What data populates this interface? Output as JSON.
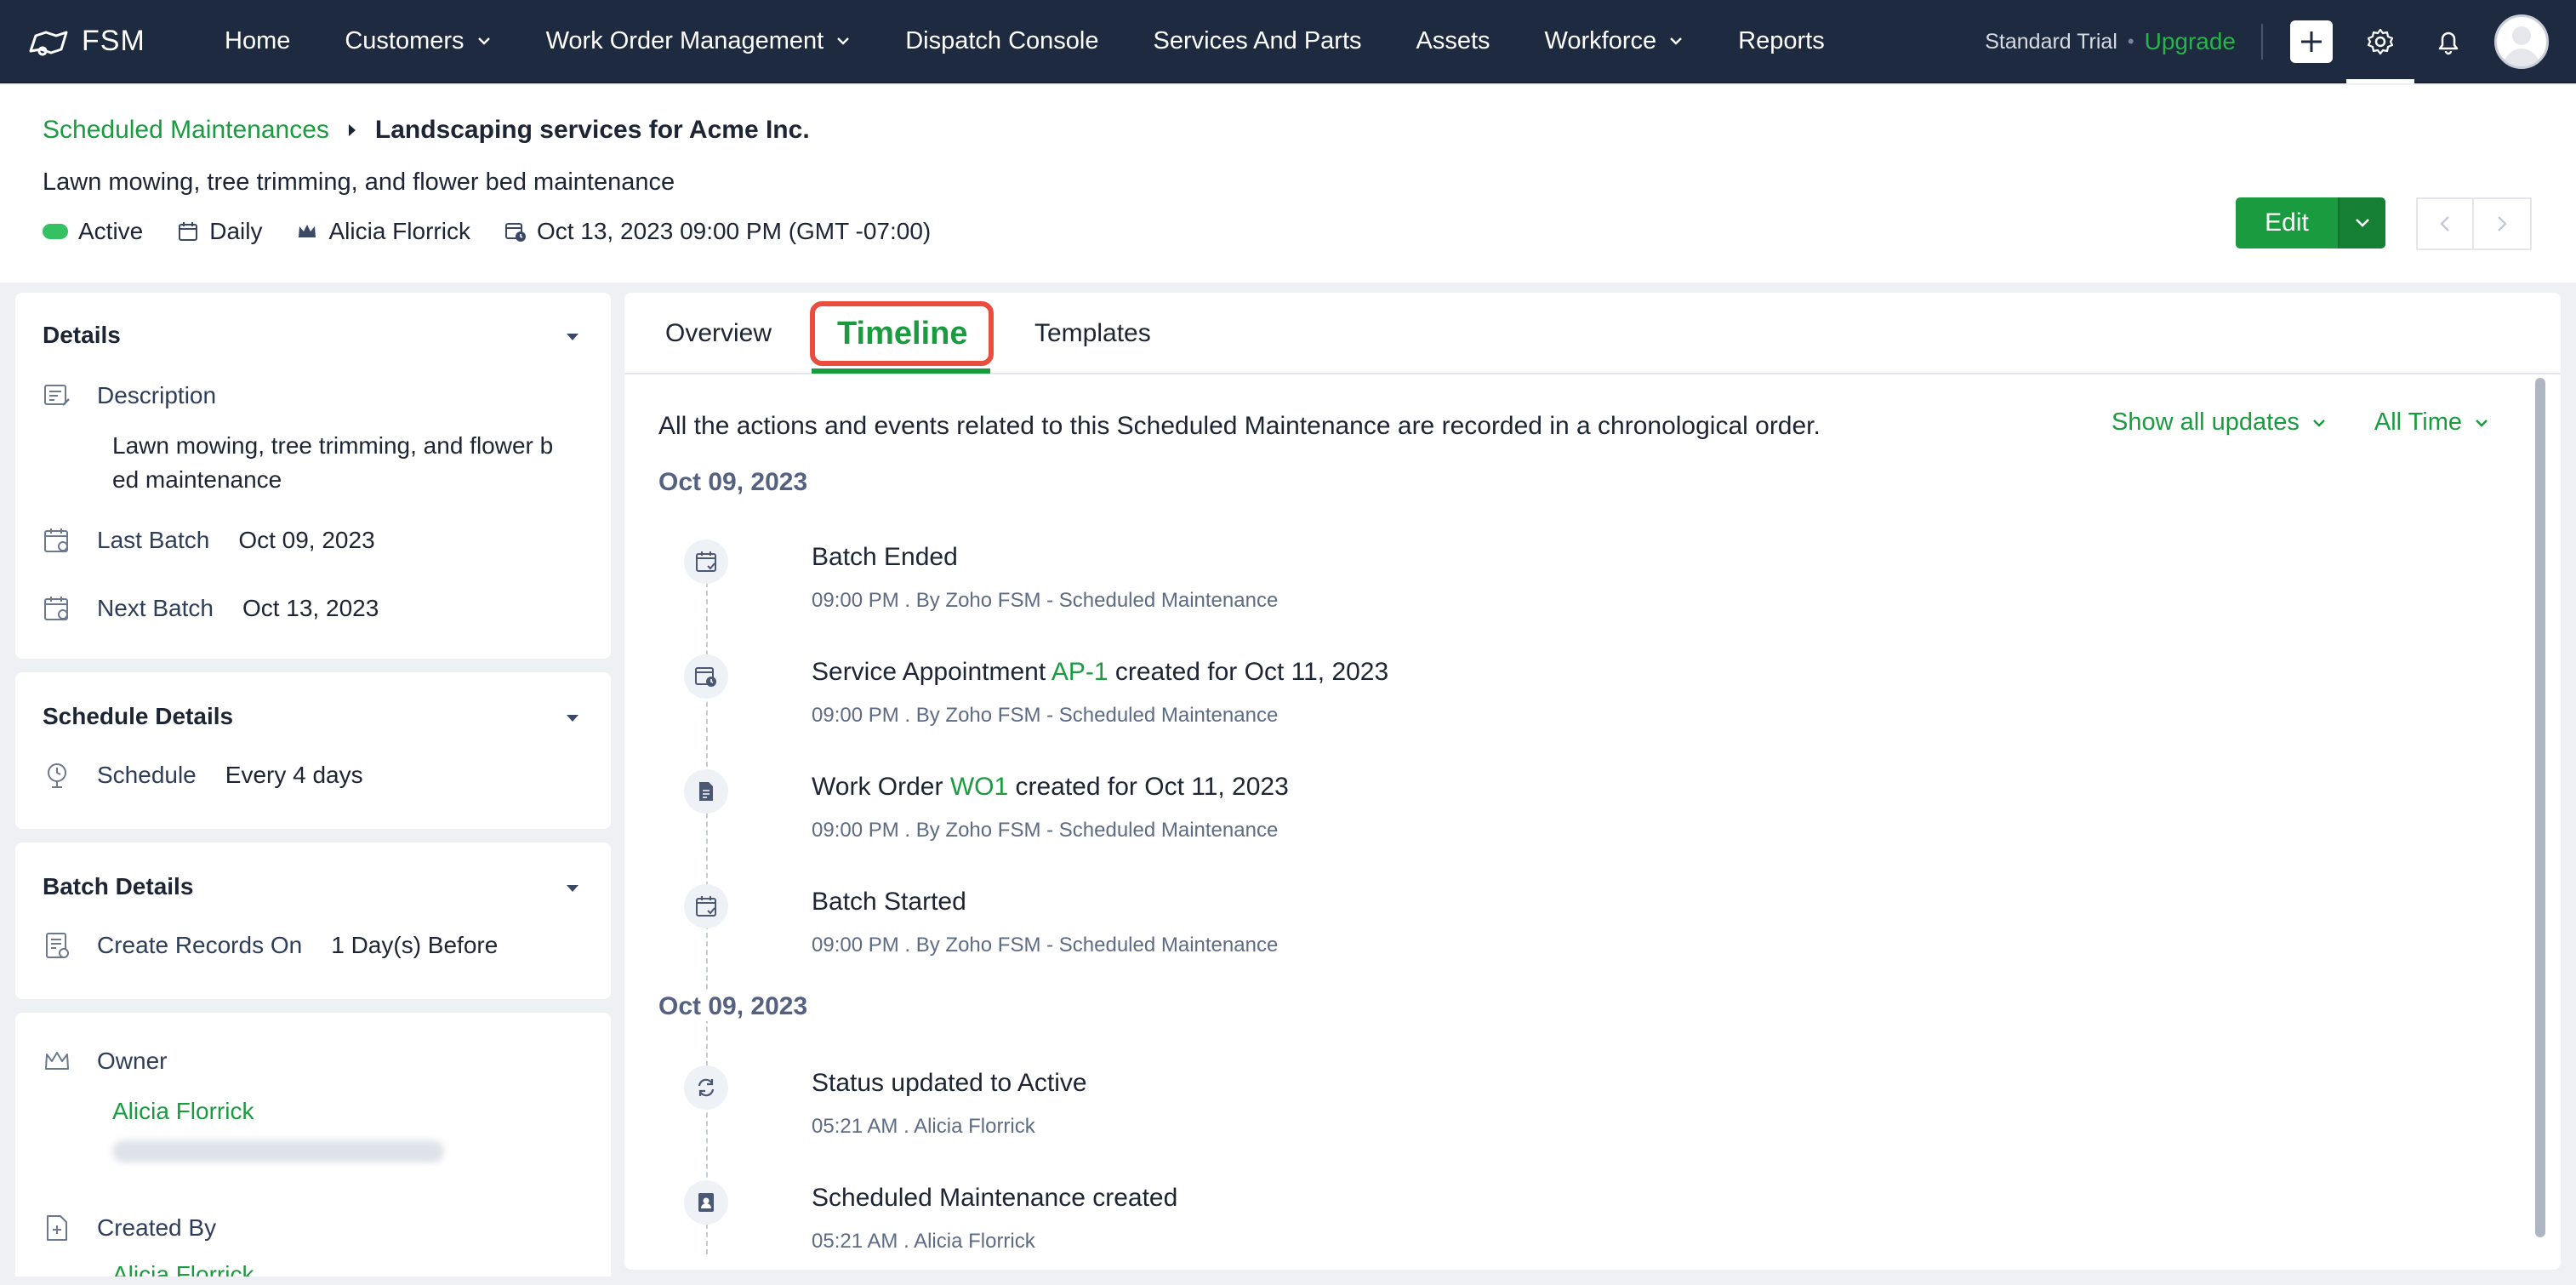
{
  "nav": {
    "brand": "FSM",
    "items": [
      {
        "label": "Home",
        "has_dropdown": false
      },
      {
        "label": "Customers",
        "has_dropdown": true
      },
      {
        "label": "Work Order Management",
        "has_dropdown": true
      },
      {
        "label": "Dispatch Console",
        "has_dropdown": false
      },
      {
        "label": "Services And Parts",
        "has_dropdown": false
      },
      {
        "label": "Assets",
        "has_dropdown": false
      },
      {
        "label": "Workforce",
        "has_dropdown": true
      },
      {
        "label": "Reports",
        "has_dropdown": false
      }
    ],
    "trial": "Standard Trial",
    "upgrade": "Upgrade",
    "icons": [
      "plus-icon",
      "gear-icon",
      "bell-icon",
      "avatar"
    ]
  },
  "header": {
    "breadcrumb_parent": "Scheduled Maintenances",
    "breadcrumb_current": "Landscaping services for Acme Inc.",
    "subtitle": "Lawn mowing, tree trimming, and flower bed maintenance",
    "status": "Active",
    "frequency": "Daily",
    "owner": "Alicia Florrick",
    "datetime": "Oct 13, 2023 09:00 PM (GMT -07:00)",
    "edit_label": "Edit"
  },
  "details": {
    "title": "Details",
    "description_label": "Description",
    "description_value_line1": "Lawn mowing, tree trimming, and flower b",
    "description_value_line2": "ed maintenance",
    "last_batch_label": "Last Batch",
    "last_batch_value": "Oct 09, 2023",
    "next_batch_label": "Next Batch",
    "next_batch_value": "Oct 13, 2023"
  },
  "schedule": {
    "title": "Schedule Details",
    "label": "Schedule",
    "value": "Every 4 days"
  },
  "batch": {
    "title": "Batch Details",
    "label": "Create Records On",
    "value": "1 Day(s) Before"
  },
  "people": {
    "owner_label": "Owner",
    "owner_name": "Alicia Florrick",
    "created_by_label": "Created By",
    "created_by_name": "Alicia Florrick"
  },
  "tabs": {
    "overview": "Overview",
    "timeline": "Timeline",
    "templates": "Templates",
    "active": "Timeline"
  },
  "timeline": {
    "intro": "All the actions and events related to this Scheduled Maintenance are recorded in a chronological order.",
    "filter_updates": "Show all updates",
    "filter_time": "All Time",
    "groups": [
      {
        "date": "Oct 09, 2023",
        "items": [
          {
            "icon": "calendar-check-icon",
            "title_pre": "Batch Ended",
            "link": "",
            "title_post": "",
            "sub": "09:00 PM . By Zoho FSM - Scheduled Maintenance"
          },
          {
            "icon": "calendar-clock-icon",
            "title_pre": "Service Appointment ",
            "link": "AP-1",
            "title_post": " created for Oct 11, 2023",
            "sub": "09:00 PM . By Zoho FSM - Scheduled Maintenance"
          },
          {
            "icon": "document-icon",
            "title_pre": "Work Order ",
            "link": "WO1",
            "title_post": " created for Oct 11, 2023",
            "sub": "09:00 PM . By Zoho FSM - Scheduled Maintenance"
          },
          {
            "icon": "calendar-check-icon",
            "title_pre": "Batch Started",
            "link": "",
            "title_post": "",
            "sub": "09:00 PM . By Zoho FSM - Scheduled Maintenance"
          }
        ]
      },
      {
        "date": "Oct 09, 2023",
        "items": [
          {
            "icon": "refresh-icon",
            "title_pre": "Status updated to Active",
            "link": "",
            "title_post": "",
            "sub": "05:21 AM . Alicia Florrick"
          },
          {
            "icon": "contact-card-icon",
            "title_pre": "Scheduled Maintenance created",
            "link": "",
            "title_post": "",
            "sub": "05:21 AM . Alicia Florrick"
          }
        ]
      }
    ]
  },
  "colors": {
    "nav_bg": "#1e2a3f",
    "accent_green": "#1a9b3f",
    "highlight_red": "#ea4d3e",
    "status_green": "#35c061"
  }
}
